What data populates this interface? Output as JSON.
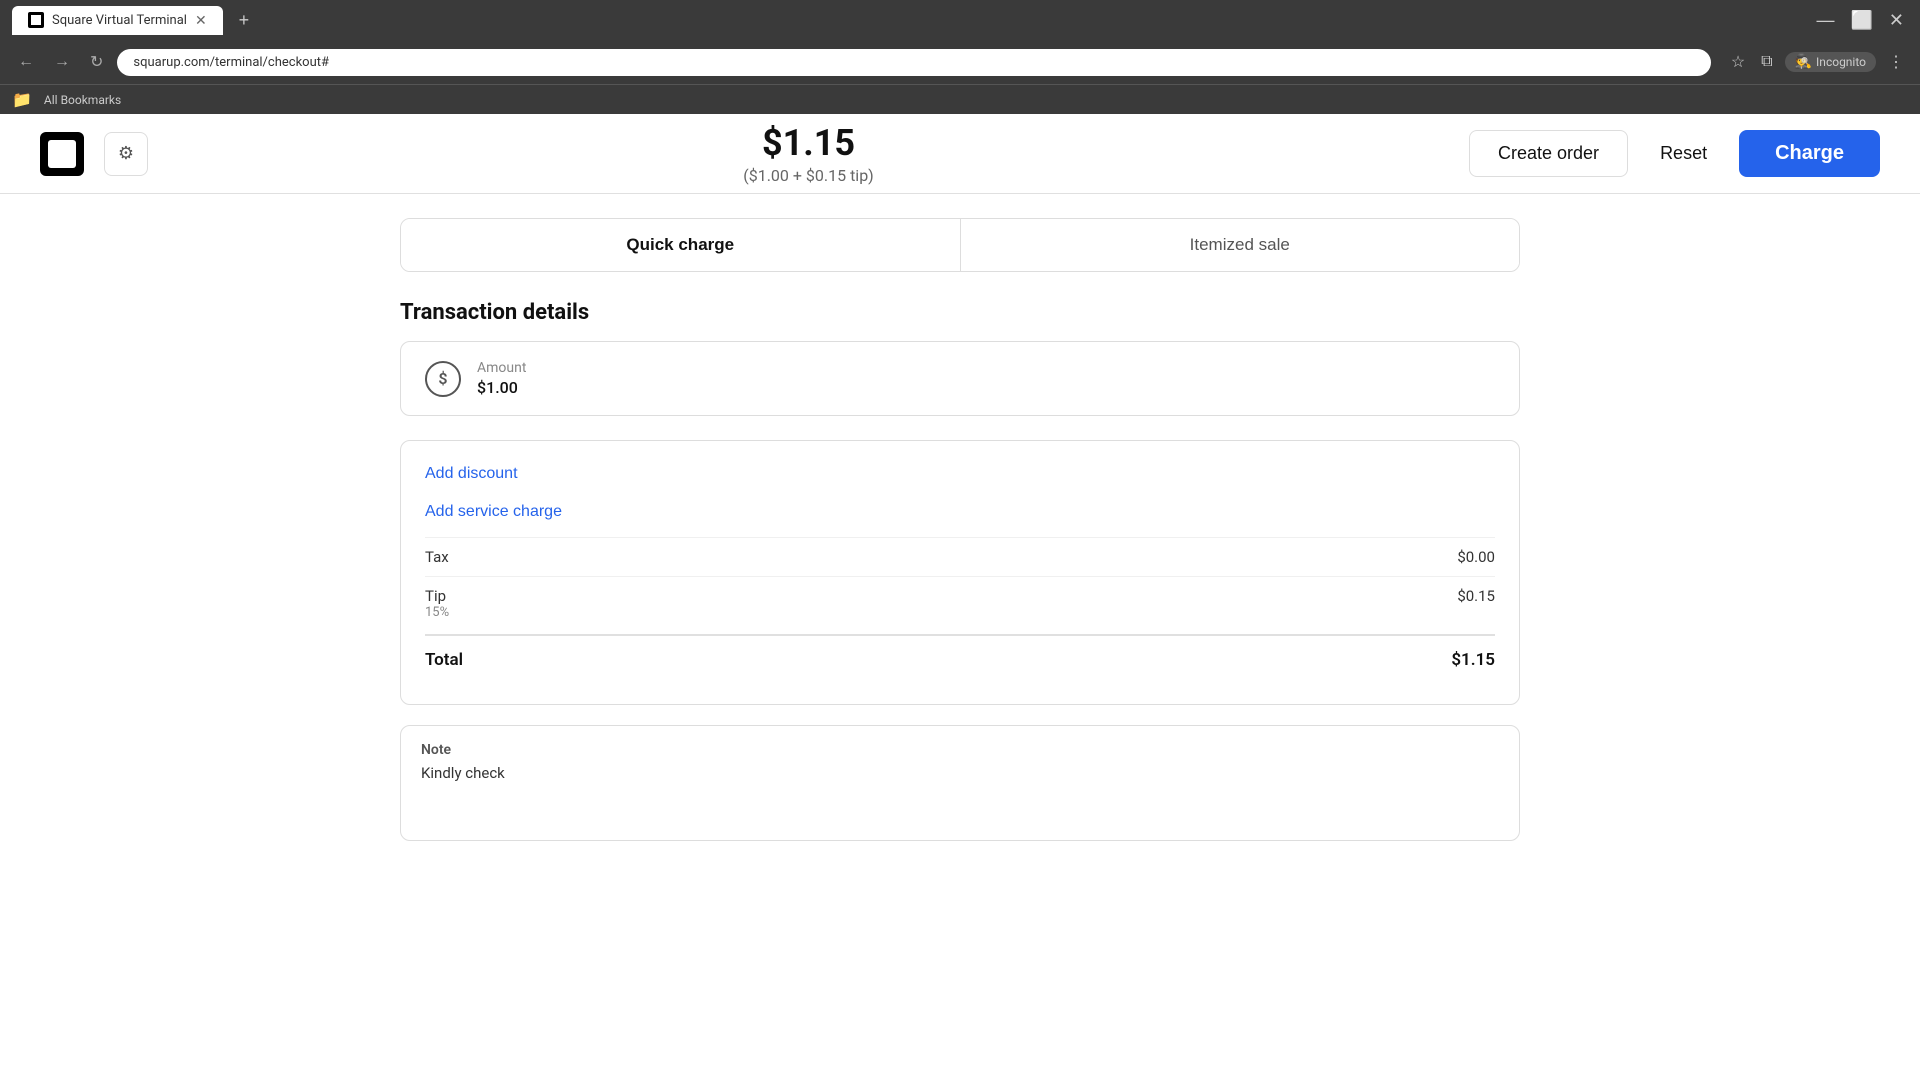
{
  "browser": {
    "tab_title": "Square Virtual Terminal",
    "url": "squarup.com/terminal/checkout#",
    "incognito_label": "Incognito",
    "bookmarks_label": "All Bookmarks",
    "new_tab_label": "+"
  },
  "header": {
    "amount": "$1.15",
    "subtitle": "($1.00 + $0.15 tip)",
    "create_order_label": "Create order",
    "reset_label": "Reset",
    "charge_label": "Charge"
  },
  "tabs": {
    "quick_charge": "Quick charge",
    "itemized_sale": "Itemized sale"
  },
  "transaction": {
    "section_title": "Transaction details",
    "amount_label": "Amount",
    "amount_value": "$1.00",
    "add_discount_label": "Add discount",
    "add_service_charge_label": "Add service charge",
    "tax_label": "Tax",
    "tax_value": "$0.00",
    "tip_label": "Tip",
    "tip_percent": "15%",
    "tip_value": "$0.15",
    "total_label": "Total",
    "total_value": "$1.15",
    "note_label": "Note",
    "note_text": "Kindly check"
  }
}
